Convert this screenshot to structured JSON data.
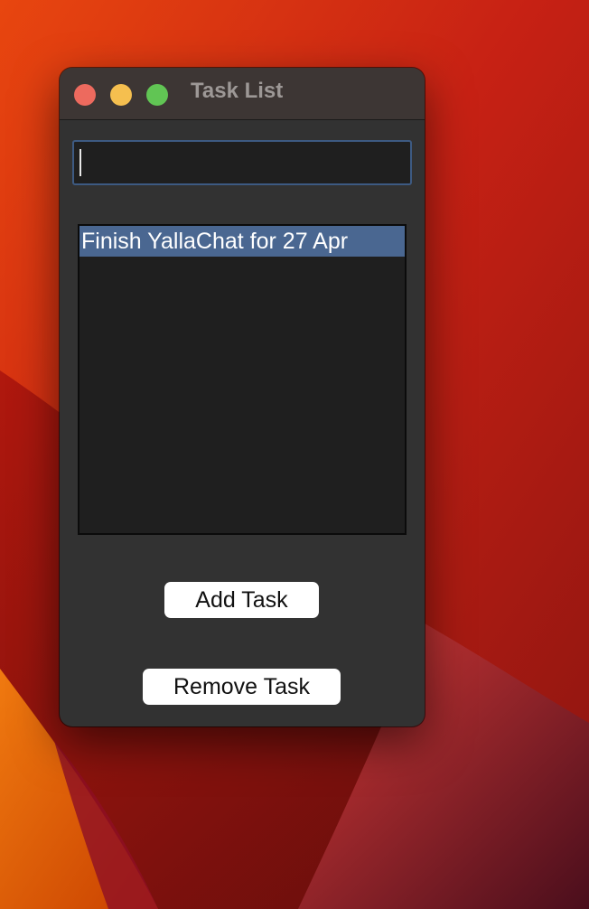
{
  "window": {
    "title": "Task List"
  },
  "task_input": {
    "value": ""
  },
  "task_list": {
    "items": [
      {
        "label": "Finish YallaChat for 27 Apr",
        "selected": true
      }
    ]
  },
  "buttons": {
    "add_label": "Add Task",
    "remove_label": "Remove Task"
  },
  "colors": {
    "selection": "#4a6791",
    "focus_ring": "#3d5a82",
    "window_bg": "#323232",
    "traffic_close": "#ed6a5e",
    "traffic_minimize": "#f5bf4f",
    "traffic_zoom": "#61c554"
  }
}
